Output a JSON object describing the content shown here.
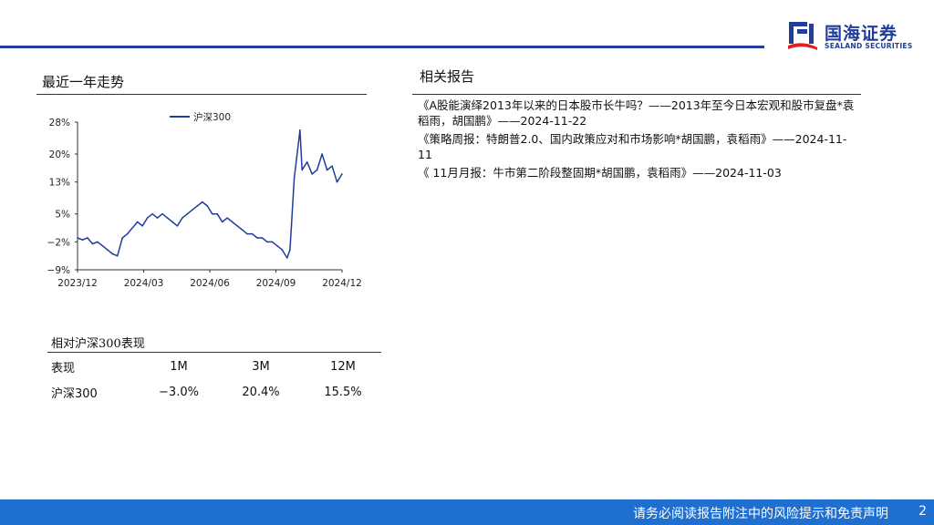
{
  "logo": {
    "name_cn": "国海证券",
    "name_en": "SEALAND SECURITIES"
  },
  "trend": {
    "title": "最近一年走势"
  },
  "related": {
    "title": "相关报告",
    "items": [
      "《A股能演绎2013年以来的日本股市长牛吗？——2013年至今日本宏观和股市复盘*袁稻雨，胡国鹏》——2024-11-22",
      "《策略周报：特朗普2.0、国内政策应对和市场影响*胡国鹏，袁稻雨》——2024-11-11",
      "《 11月月报：牛市第二阶段整固期*胡国鹏，袁稻雨》——2024-11-03"
    ]
  },
  "performance": {
    "title": "相对沪深300表现",
    "headers": [
      "表现",
      "1M",
      "3M",
      "12M"
    ],
    "rows": [
      [
        "沪深300",
        "−3.0%",
        "20.4%",
        "15.5%"
      ]
    ]
  },
  "chart_data": {
    "type": "line",
    "title": "",
    "xlabel": "",
    "ylabel": "",
    "ylim": [
      -9,
      28
    ],
    "y_ticks": [
      "28%",
      "20%",
      "13%",
      "5%",
      "−2%",
      "−9%"
    ],
    "y_tick_values": [
      28,
      20,
      13,
      5,
      -2,
      -9
    ],
    "x_ticks": [
      "2023/12",
      "2024/03",
      "2024/06",
      "2024/09",
      "2024/12"
    ],
    "legend": "top-center",
    "color": "#1f3d99",
    "series": [
      {
        "name": "沪深300",
        "x": [
          "2023-12-01",
          "2023-12-08",
          "2023-12-15",
          "2023-12-22",
          "2023-12-29",
          "2024-01-05",
          "2024-01-12",
          "2024-01-19",
          "2024-01-26",
          "2024-02-02",
          "2024-02-09",
          "2024-02-23",
          "2024-03-01",
          "2024-03-08",
          "2024-03-15",
          "2024-03-22",
          "2024-03-29",
          "2024-04-05",
          "2024-04-12",
          "2024-04-19",
          "2024-04-26",
          "2024-05-03",
          "2024-05-10",
          "2024-05-17",
          "2024-05-24",
          "2024-05-31",
          "2024-06-07",
          "2024-06-14",
          "2024-06-21",
          "2024-06-28",
          "2024-07-05",
          "2024-07-12",
          "2024-07-19",
          "2024-07-26",
          "2024-08-02",
          "2024-08-09",
          "2024-08-16",
          "2024-08-23",
          "2024-08-30",
          "2024-09-06",
          "2024-09-13",
          "2024-09-20",
          "2024-09-24",
          "2024-09-26",
          "2024-09-30",
          "2024-10-08",
          "2024-10-11",
          "2024-10-18",
          "2024-10-25",
          "2024-11-01",
          "2024-11-08",
          "2024-11-15",
          "2024-11-22",
          "2024-11-29",
          "2024-12-06"
        ],
        "values": [
          -1,
          -1.5,
          -1,
          -2.5,
          -2,
          -3,
          -4,
          -5,
          -5.5,
          -1,
          0,
          3,
          2,
          4,
          5,
          4,
          5,
          4,
          3,
          2,
          4,
          5,
          6,
          7,
          8,
          7,
          5,
          5,
          3,
          4,
          3,
          2,
          1,
          0,
          0,
          -1,
          -1,
          -2,
          -2,
          -3,
          -4,
          -6,
          -4,
          2,
          14,
          26,
          16,
          18,
          15,
          16,
          20,
          16,
          17,
          13,
          15
        ]
      }
    ]
  },
  "footer": {
    "disclaimer": "请务必阅读报告附注中的风险提示和免责声明",
    "page": "2"
  }
}
